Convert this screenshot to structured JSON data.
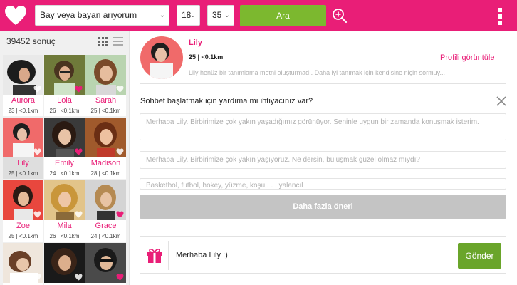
{
  "header": {
    "gender_select": "Bay veya bayan arıyorum",
    "age_min": "18",
    "age_max": "35",
    "search_label": "Ara",
    "accent_color": "#e91e77",
    "button_color": "#7cb82f"
  },
  "results": {
    "count_label": "39452 sonuç",
    "tiles": [
      {
        "name": "Aurora",
        "info": "23 | <0.1km"
      },
      {
        "name": "Lola",
        "info": "26 | <0.1km"
      },
      {
        "name": "Sarah",
        "info": "25 | <0.1km"
      },
      {
        "name": "Lily",
        "info": "25 | <0.1km"
      },
      {
        "name": "Emily",
        "info": "24 | <0.1km"
      },
      {
        "name": "Madison",
        "info": "28 | <0.1km"
      },
      {
        "name": "Zoe",
        "info": "25 | <0.1km"
      },
      {
        "name": "Mila",
        "info": "26 | <0.1km"
      },
      {
        "name": "Grace",
        "info": "24 | <0.1km"
      },
      {
        "name": "",
        "info": ""
      },
      {
        "name": "",
        "info": ""
      },
      {
        "name": "",
        "info": ""
      }
    ]
  },
  "profile": {
    "name": "Lily",
    "info": "25 | <0.1km",
    "view_profile_label": "Profili görüntüle",
    "description": "Lily henüz bir tanımlama metni oluşturmadı. Daha iyi tanımak için kendisine niçin sormuy..."
  },
  "chat_help": {
    "title": "Sohbet başlatmak için yardıma mı ihtiyacınız var?",
    "suggestions": [
      "Merhaba Lily. Birbirimize çok yakın yaşadığımız görünüyor. Seninle uygun bir zamanda konuşmak isterim.",
      "Merhaba Lily. Birbirimize çok yakın yaşıyoruz. Ne dersin, buluşmak güzel olmaz mıydı?",
      "Basketbol, futbol, hokey, yüzme, koşu . . . yalancıl"
    ],
    "more_label": "Daha fazla öneri"
  },
  "composer": {
    "message": "Merhaba Lily ;)",
    "send_label": "Gönder"
  },
  "icons": {
    "logo": "heart-icon",
    "zoom": "zoom-in-icon",
    "menu": "overflow-menu-icon",
    "grid": "grid-view-icon",
    "list": "list-view-icon",
    "close": "close-icon",
    "gift": "gift-icon",
    "tile_favorite": "heart-icon"
  }
}
